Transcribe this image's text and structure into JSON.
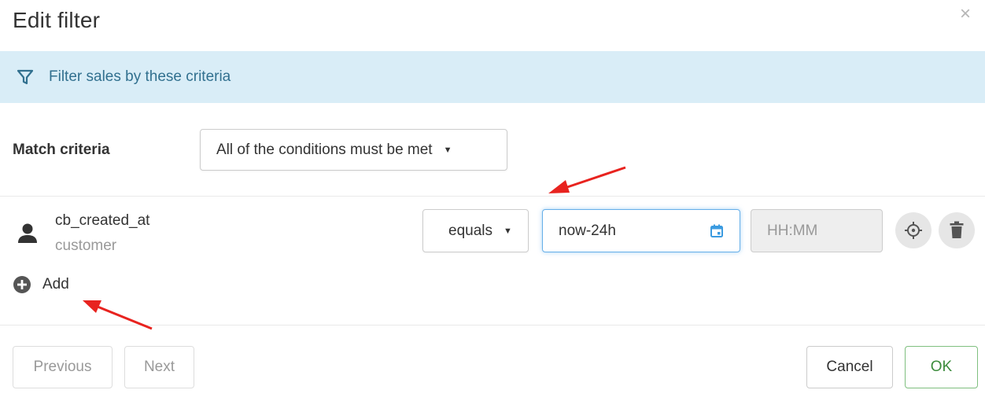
{
  "dialog": {
    "title": "Edit filter",
    "close_glyph": "×"
  },
  "banner": {
    "icon": "filter-icon",
    "text": "Filter sales by these criteria",
    "bg_color": "#d9edf7",
    "text_color": "#31708f"
  },
  "match": {
    "label": "Match criteria",
    "selected": "All of the conditions must be met"
  },
  "condition": {
    "icon": "person-icon",
    "field_name": "cb_created_at",
    "entity": "customer",
    "operator": "equals",
    "date_value": "now-24h",
    "time_placeholder": "HH:MM"
  },
  "add_label": "Add",
  "footer": {
    "previous": "Previous",
    "next": "Next",
    "cancel": "Cancel",
    "ok": "OK"
  },
  "colors": {
    "focus_border": "#66afe9",
    "ok_text": "#3c8c3c",
    "annotation_arrow": "#e8231f"
  }
}
